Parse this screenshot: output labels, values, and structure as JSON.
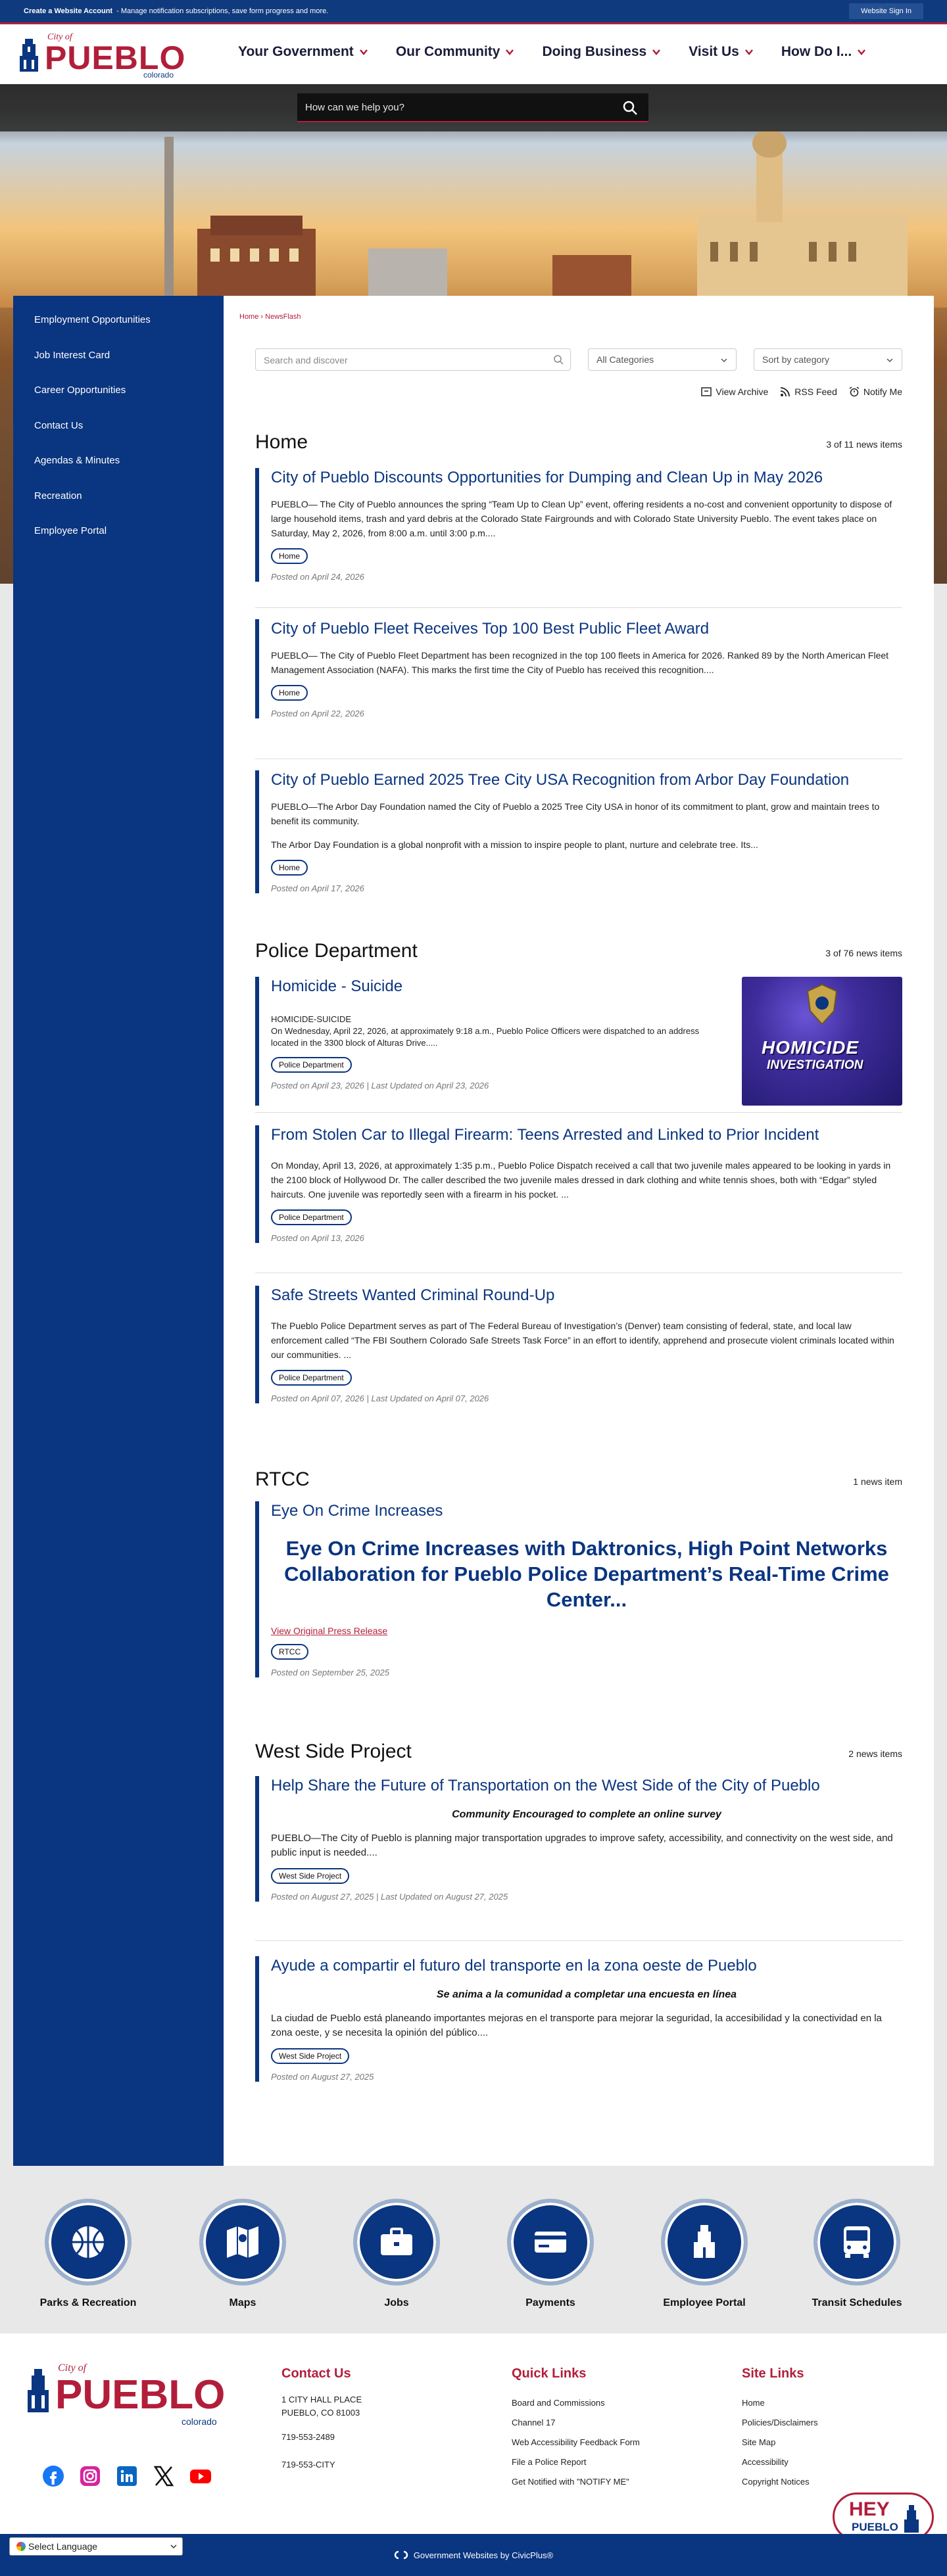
{
  "topbar": {
    "create_account": "Create a Website Account",
    "create_account_desc": "- Manage notification subscriptions, save form progress and more.",
    "sign_in": "Website Sign In"
  },
  "logo": {
    "city_of": "City of",
    "name": "PUEBLO",
    "state": "colorado"
  },
  "nav": [
    {
      "label": "Your Government"
    },
    {
      "label": "Our Community"
    },
    {
      "label": "Doing Business"
    },
    {
      "label": "Visit Us"
    },
    {
      "label": "How Do I..."
    }
  ],
  "site_search": {
    "placeholder": "How can we help you?"
  },
  "sidebar": {
    "items": [
      {
        "label": "Employment Opportunities"
      },
      {
        "label": "Job Interest Card"
      },
      {
        "label": "Career Opportunities"
      },
      {
        "label": "Contact Us"
      },
      {
        "label": "Agendas & Minutes"
      },
      {
        "label": "Recreation"
      },
      {
        "label": "Employee Portal"
      }
    ]
  },
  "breadcrumb": {
    "home": "Home",
    "sep": "›",
    "current": "NewsFlash"
  },
  "filters": {
    "search_placeholder": "Search and discover",
    "category": "All Categories",
    "sort": "Sort by category"
  },
  "tools": {
    "archive": "View Archive",
    "rss": "RSS Feed",
    "notify": "Notify Me"
  },
  "sections": [
    {
      "title": "Home",
      "count": "3 of 11 news items",
      "articles": [
        {
          "title": "City of Pueblo Discounts Opportunities for Dumping and Clean Up in May 2026",
          "body": "PUEBLO— The City of Pueblo announces the spring “Team Up to Clean Up” event, offering residents a no-cost and convenient opportunity to dispose of large household items, trash and yard debris at the Colorado State Fairgrounds and with Colorado State University Pueblo. The event takes place on Saturday, May 2, 2026, from 8:00 a.m. until 3:00 p.m....",
          "tag": "Home",
          "posted": "Posted on April 24, 2026"
        },
        {
          "title": "City of Pueblo Fleet Receives Top 100 Best Public Fleet Award",
          "body": "PUEBLO— The City of Pueblo Fleet Department has been recognized in the top 100 fleets in America for 2026. Ranked 89 by the North American Fleet Management Association (NAFA). This marks the first time the City of Pueblo has received this recognition....",
          "tag": "Home",
          "posted": "Posted on April 22, 2026"
        },
        {
          "title": "City of Pueblo Earned 2025 Tree City USA Recognition from Arbor Day Foundation",
          "body": "PUEBLO—The Arbor Day Foundation named the City of Pueblo a 2025 Tree City USA in honor of its commitment to plant, grow and maintain trees to benefit its community.",
          "body2": "The Arbor Day Foundation is a global nonprofit with a mission to inspire people to plant, nurture and celebrate tree. Its...",
          "tag": "Home",
          "posted": "Posted on April 17, 2026"
        }
      ]
    },
    {
      "title": "Police Department",
      "count": "3 of 76 news items",
      "articles": [
        {
          "title": "Homicide - Suicide",
          "body_heading": "HOMICIDE-SUICIDE",
          "body": "On Wednesday, April 22, 2026, at approximately 9:18 a.m., Pueblo Police Officers were dispatched to an address located in the 3300 block of Alturas Drive.....",
          "image_text_1": "HOMICIDE",
          "image_text_2": "INVESTIGATION",
          "tag": "Police Department",
          "posted": "Posted on April 23, 2026 | Last Updated on April 23, 2026"
        },
        {
          "title": "From Stolen Car to Illegal Firearm: Teens Arrested and Linked to Prior Incident",
          "body": "On Monday, April 13, 2026, at approximately 1:35 p.m., Pueblo Police Dispatch received a call that two juvenile males appeared to be looking in yards in the 2100 block of Hollywood Dr. The caller described the two juvenile males dressed in dark clothing and white tennis shoes, both with “Edgar” styled haircuts. One juvenile was reportedly seen with a firearm in his pocket.  ...",
          "tag": "Police Department",
          "posted": "Posted on April 13, 2026"
        },
        {
          "title": "Safe Streets Wanted Criminal Round-Up",
          "body": "The Pueblo Police Department serves as part of The Federal Bureau of Investigation’s (Denver) team consisting of federal, state, and local law enforcement called “The FBI Southern Colorado Safe Streets Task Force” in an effort to identify, apprehend and prosecute violent criminals located within our communities.  ...",
          "tag": "Police Department",
          "posted": "Posted on April 07, 2026 | Last Updated on April 07, 2026"
        }
      ]
    },
    {
      "title": "RTCC",
      "count": "1 news item",
      "articles": [
        {
          "title": "Eye On Crime Increases",
          "headline": "Eye On Crime Increases with Daktronics, High Point Networks Collaboration for Pueblo Police Department’s Real-Time Crime Center...",
          "link": "View Original Press Release",
          "tag": "RTCC",
          "posted": "Posted on September 25, 2025"
        }
      ]
    },
    {
      "title": "West Side Project",
      "count": "2 news items",
      "articles": [
        {
          "title": "Help Share the Future of Transportation on the West Side of the City of Pueblo",
          "subhead": "Community Encouraged to complete an online survey",
          "body": "PUEBLO—The City of Pueblo is planning major transportation upgrades to improve safety, accessibility, and connectivity on the west side, and public input is needed....",
          "tag": "West Side Project",
          "posted": "Posted on August 27, 2025 | Last Updated on August 27, 2025"
        },
        {
          "title": "Ayude a compartir el futuro del transporte en la zona oeste de Pueblo",
          "subhead": "Se anima a la comunidad a completar una encuesta en línea",
          "body": "La ciudad de Pueblo está planeando importantes mejoras en el transporte para mejorar la seguridad, la accesibilidad y la conectividad en la zona oeste, y se necesita la opinión del público....",
          "tag": "West Side Project",
          "posted": "Posted on August 27, 2025"
        }
      ]
    }
  ],
  "tiles": [
    {
      "label": "Parks & Recreation",
      "icon": "basketball-icon"
    },
    {
      "label": "Maps",
      "icon": "map-icon"
    },
    {
      "label": "Jobs",
      "icon": "briefcase-icon"
    },
    {
      "label": "Payments",
      "icon": "credit-card-icon"
    },
    {
      "label": "Employee Portal",
      "icon": "building-icon"
    },
    {
      "label": "Transit Schedules",
      "icon": "bus-icon"
    }
  ],
  "footer": {
    "contact": {
      "heading": "Contact Us",
      "address1": "1 CITY HALL PLACE",
      "address2": "PUEBLO, CO 81003",
      "phone": "719-553-2489",
      "phone2": "719-553-CITY"
    },
    "quick_links": {
      "heading": "Quick Links",
      "items": [
        "Board and Commissions",
        "Channel 17",
        "Web Accessibility Feedback Form",
        "File a Police Report",
        "Get Notified with \"NOTIFY ME\""
      ]
    },
    "site_links": {
      "heading": "Site Links",
      "items": [
        "Home",
        "Policies/Disclaimers",
        "Site Map",
        "Accessibility",
        "Copyright Notices"
      ]
    },
    "hey": {
      "line1": "HEY",
      "line2": "PUEBLO"
    },
    "language": "Select Language",
    "powered": "Government Websites by CivicPlus®"
  },
  "colors": {
    "navy": "#0a3580",
    "red": "#b21e3a",
    "topbar": "#0f3a7d"
  }
}
